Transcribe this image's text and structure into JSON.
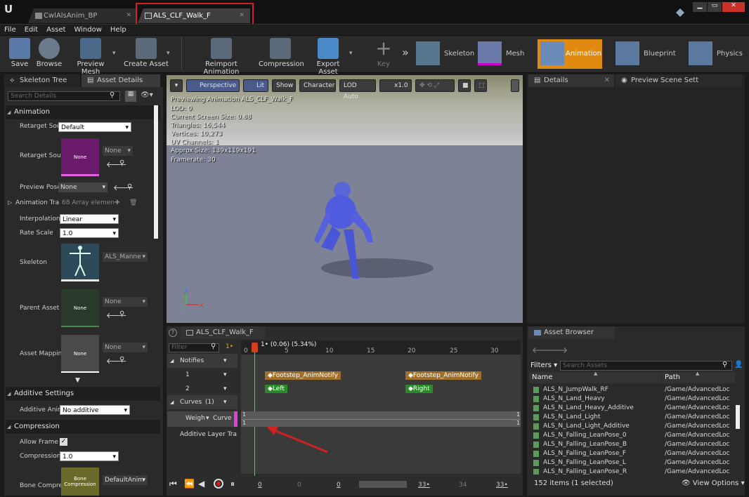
{
  "window": {
    "tabs": [
      {
        "label": "CwlAlsAnim_BP"
      },
      {
        "label": "ALS_CLF_Walk_F"
      }
    ]
  },
  "menu": [
    "File",
    "Edit",
    "Asset",
    "Window",
    "Help"
  ],
  "toolbar": {
    "save": "Save",
    "browse": "Browse",
    "preview_mesh": "Preview Mesh",
    "create_asset": "Create Asset",
    "reimport": "Reimport Animation",
    "compression": "Compression",
    "export": "Export Asset",
    "key": "Key",
    "modes": {
      "skeleton": "Skeleton",
      "mesh": "Mesh",
      "animation": "Animation",
      "blueprint": "Blueprint",
      "physics": "Physics"
    }
  },
  "left_panel": {
    "tabs": {
      "skeleton_tree": "Skeleton Tree",
      "asset_details": "Asset Details"
    },
    "search_placeholder": "Search Details",
    "sections": {
      "animation": "Animation",
      "additive": "Additive Settings",
      "compression": "Compression"
    },
    "rows": {
      "retarget_source": "Retarget Sour",
      "retarget_source_val": "Default",
      "retarget_source2": "Retarget Sour",
      "none": "None",
      "preview_pose": "Preview Pose",
      "preview_pose_val": "None",
      "anim_track": "Animation Tra",
      "anim_track_val": "68 Array elemen",
      "interpolation": "Interpolation",
      "interpolation_val": "Linear",
      "rate_scale": "Rate Scale",
      "rate_scale_val": "1.0",
      "skeleton": "Skeleton",
      "skeleton_val": "ALS_Manne",
      "parent_asset": "Parent Asset",
      "parent_asset_val": "None",
      "asset_mapping": "Asset Mappin",
      "asset_mapping_val": "None",
      "additive_anim": "Additive Anim",
      "additive_anim_val": "No additive",
      "allow_frame": "Allow Frame S",
      "compression_ratio": "Compression I",
      "compression_ratio_val": "1.0",
      "bone_compress": "Bone Compres",
      "bone_compress_val": "DefaultAnim",
      "bone_thumb": "Bone Compression"
    }
  },
  "viewport": {
    "buttons": {
      "perspective": "Perspective",
      "lit": "Lit",
      "show": "Show",
      "character": "Character",
      "lod": "LOD Auto",
      "speed": "x1.0"
    },
    "overlay": [
      "Previewing Animation ALS_CLF_Walk_F",
      "LOD: 0",
      "Current Screen Size: 0.88",
      "Triangles: 16,544",
      "Vertices: 10,273",
      "UV Channels: 1",
      "Approx Size: 139x119x191",
      "Framerate: 30"
    ]
  },
  "right_panel": {
    "tabs": {
      "details": "Details",
      "preview_scene": "Preview Scene Sett"
    }
  },
  "timeline": {
    "tab": "ALS_CLF_Walk_F",
    "filter_placeholder": "Filter",
    "frame_indicator": "1•",
    "playhead": "1• (0.06) (5.34%)",
    "ticks": [
      "0",
      "5",
      "10",
      "15",
      "20",
      "25",
      "30"
    ],
    "notifies": "Notifies",
    "track1": "1",
    "track2": "2",
    "curves": "Curves",
    "curves_count": "(1)",
    "weight": "Weigh",
    "curve": "Curve",
    "additive_layer": "Additive Layer Tra",
    "notify_events": [
      {
        "label": "Footstep_AnimNotify"
      },
      {
        "label": "Footstep_AnimNotify"
      }
    ],
    "notify_markers": [
      {
        "label": "Left"
      },
      {
        "label": "Right"
      }
    ],
    "curve_val_left": "1",
    "curve_val_left2": "1",
    "curve_val_right": "1",
    "curve_val_right2": "1",
    "bottom_nums": [
      "0",
      "0",
      "0",
      "33•",
      "34",
      "33•"
    ]
  },
  "asset_browser": {
    "tab": "Asset Browser",
    "filters": "Filters",
    "search_placeholder": "Search Assets",
    "col_name": "Name",
    "col_path": "Path",
    "rows": [
      {
        "name": "ALS_N_JumpWalk_RF",
        "path": "/Game/AdvancedLoc"
      },
      {
        "name": "ALS_N_Land_Heavy",
        "path": "/Game/AdvancedLoc"
      },
      {
        "name": "ALS_N_Land_Heavy_Additive",
        "path": "/Game/AdvancedLoc"
      },
      {
        "name": "ALS_N_Land_Light",
        "path": "/Game/AdvancedLoc"
      },
      {
        "name": "ALS_N_Land_Light_Additive",
        "path": "/Game/AdvancedLoc"
      },
      {
        "name": "ALS_N_Falling_LeanPose_0",
        "path": "/Game/AdvancedLoc"
      },
      {
        "name": "ALS_N_Falling_LeanPose_B",
        "path": "/Game/AdvancedLoc"
      },
      {
        "name": "ALS_N_Falling_LeanPose_F",
        "path": "/Game/AdvancedLoc"
      },
      {
        "name": "ALS_N_Falling_LeanPose_L",
        "path": "/Game/AdvancedLoc"
      },
      {
        "name": "ALS_N_Falling_LeanPose_R",
        "path": "/Game/AdvancedLoc"
      }
    ],
    "status": "152 items (1 selected)",
    "view_options": "View Options"
  }
}
